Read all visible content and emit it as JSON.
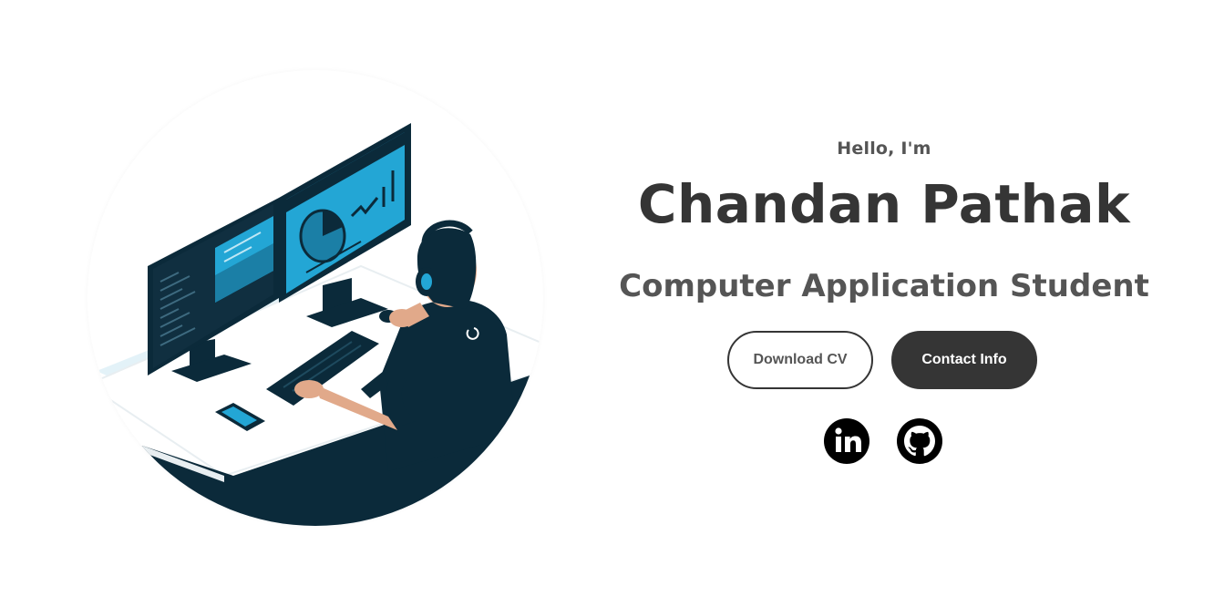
{
  "hero": {
    "greeting": "Hello, I'm",
    "name": "Chandan Pathak",
    "role": "Computer Application Student"
  },
  "buttons": {
    "download_cv": "Download CV",
    "contact_info": "Contact Info"
  },
  "socials": {
    "linkedin_icon": "linkedin-icon",
    "github_icon": "github-icon"
  },
  "colors": {
    "text_dark": "#353535",
    "text_muted": "#555555",
    "illustration_navy": "#0b2a3a",
    "illustration_blue": "#23a6d5"
  }
}
